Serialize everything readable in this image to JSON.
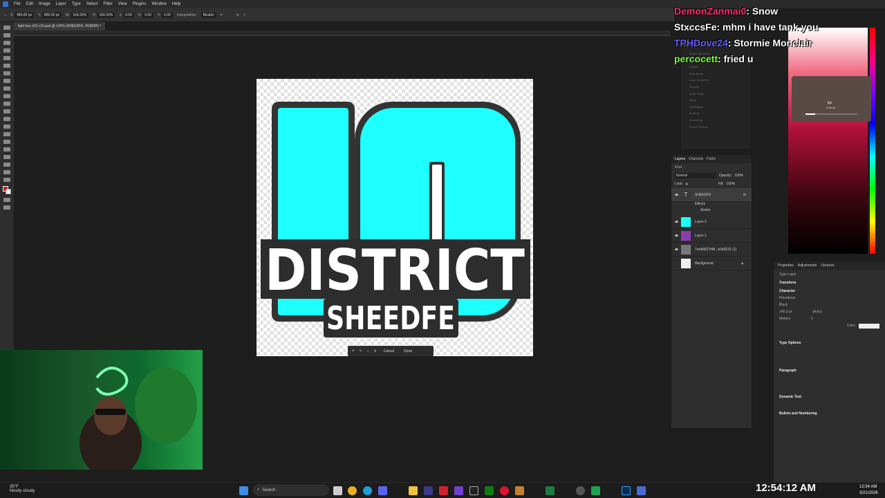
{
  "menu": [
    "File",
    "Edit",
    "Image",
    "Layer",
    "Type",
    "Select",
    "Filter",
    "View",
    "Plugins",
    "Window",
    "Help"
  ],
  "options": {
    "x": "485.85 px",
    "y": "850.00 px",
    "w": "169.33%",
    "h": "169.33%",
    "angle": "0.00",
    "hskew": "0.00",
    "vskew": "0.00",
    "interp_label": "Interpolation:",
    "interp": "Bicubic"
  },
  "document_tab": "light box d10 v10.psd @ 120% (SHEEDFE, RGB/8#) *",
  "artwork": {
    "big_number": "10",
    "word1": "DISTRICT",
    "word2": "SHEEDFE",
    "colors": {
      "cyan": "#1effff",
      "outline": "#333333"
    }
  },
  "transform_bar": {
    "cancel": "Cancel",
    "done": "Done"
  },
  "chat": [
    {
      "user": "DemonZanmai0",
      "msg": "Snow"
    },
    {
      "user": "StxccsFe",
      "msg": "mhm i have tank you"
    },
    {
      "user": "TPHDove24",
      "msg": "Stormie Monclair"
    },
    {
      "user": "percocett",
      "msg": "fried u"
    }
  ],
  "brush_panel": {
    "tabs": [
      "Brush Settings",
      "Brushes"
    ],
    "items": [
      "Shape Dynamics",
      "Scattering",
      "Texture",
      "Dual Brush",
      "Color Dynamics",
      "Transfer",
      "Brush Pose",
      "Noise",
      "Wet Edges",
      "Build-up",
      "Smoothing",
      "Protect Texture"
    ]
  },
  "video": {
    "title": "loc",
    "subtitle": "lil tecca"
  },
  "layers": {
    "tabs": [
      "Layers",
      "Channels",
      "Paths"
    ],
    "blend": "Normal",
    "opacity_label": "Opacity:",
    "opacity": "100%",
    "lock_label": "Lock:",
    "fill_label": "Fill:",
    "fill": "100%",
    "kind": "Kind",
    "rows": [
      {
        "name": "SHEEDFE",
        "type": "text",
        "fx": "fx"
      },
      {
        "name": "Effects",
        "type": "sub"
      },
      {
        "name": "Stroke",
        "type": "sub"
      },
      {
        "name": "Layer 2",
        "type": "img"
      },
      {
        "name": "Layer 1",
        "type": "img"
      },
      {
        "name": "7eeb8627f48...b3d9232 (1)",
        "type": "img"
      },
      {
        "name": "Background",
        "type": "bg"
      }
    ]
  },
  "properties": {
    "tabs": [
      "Properties",
      "Adjustments",
      "Libraries"
    ],
    "kind": "Type Layer",
    "transform": "Transform",
    "character": "Character",
    "font": "Pricedown",
    "style": "Black",
    "size": "146.9 pt",
    "leading": "(Auto)",
    "kerning": "Metrics",
    "tracking": "0",
    "color_label": "Color:",
    "type_options": "Type Options",
    "paragraph": "Paragraph",
    "dynamic_text": "Dynamic Text",
    "bullets": "Bullets and Numbering"
  },
  "taskbar": {
    "temp": "35°F",
    "weather": "Mostly cloudy",
    "search": "Search",
    "clock_big": "12:54:12 AM",
    "time": "12:54 AM",
    "date": "3/21/2026"
  }
}
